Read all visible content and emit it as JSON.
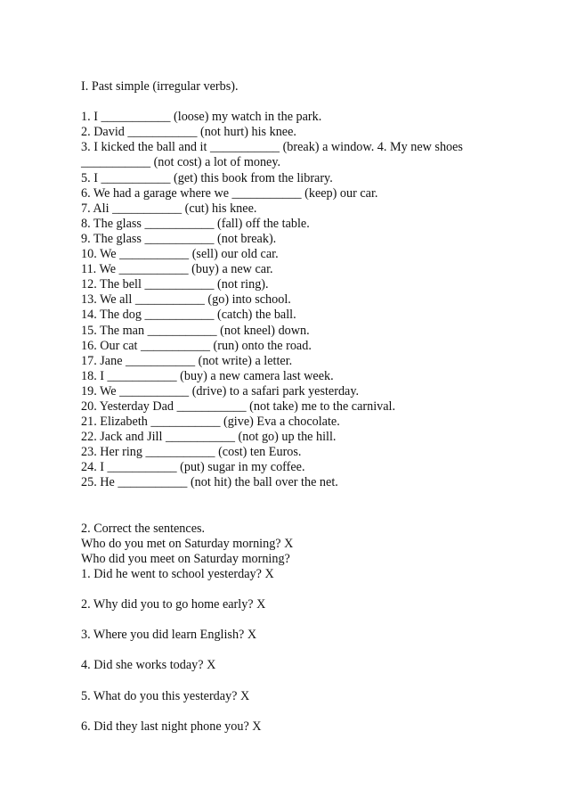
{
  "section1": {
    "heading": "I. Past simple (irregular verbs).",
    "items": [
      "1. I ___________ (loose) my watch in the park.",
      "2. David ___________ (not hurt) his knee.",
      "3. I kicked the ball and it ___________ (break) a window. 4. My new shoes",
      "___________ (not cost) a lot of money.",
      "5. I ___________ (get) this book from the library.",
      "6. We had a garage where we ___________ (keep) our car.",
      "7. Ali ___________ (cut) his knee.",
      "8. The glass ___________ (fall) off the table.",
      "9. The glass ___________ (not break).",
      "10. We ___________ (sell) our old car.",
      "11. We ___________ (buy) a new car.",
      "12. The bell ___________ (not ring).",
      "13. We all ___________ (go) into school.",
      "14. The dog ___________ (catch) the ball.",
      "15. The man ___________ (not kneel) down.",
      "16. Our cat ___________ (run) onto the road.",
      "17. Jane ___________ (not write) a letter.",
      "18. I ___________ (buy) a new camera last week.",
      "19. We ___________ (drive) to a safari park yesterday.",
      "20. Yesterday Dad ___________ (not take) me to the carnival.",
      "21. Elizabeth ___________ (give) Eva a chocolate.",
      "22. Jack and Jill ___________ (not go) up the hill.",
      "23. Her ring ___________ (cost) ten Euros.",
      "24. I ___________ (put) sugar in my coffee.",
      "25. He ___________ (not hit) the ball over the net."
    ]
  },
  "section2": {
    "heading": "2. Correct the sentences.",
    "example_wrong": "Who do you met on Saturday morning? X",
    "example_right": "Who did you meet on Saturday morning?",
    "items": [
      "1. Did he went to school yesterday? X",
      "2. Why did you to go home early? X",
      "3. Where you did learn English? X",
      "4. Did she works today? X",
      "5. What do you this yesterday? X",
      "6. Did they last night phone you? X"
    ]
  }
}
